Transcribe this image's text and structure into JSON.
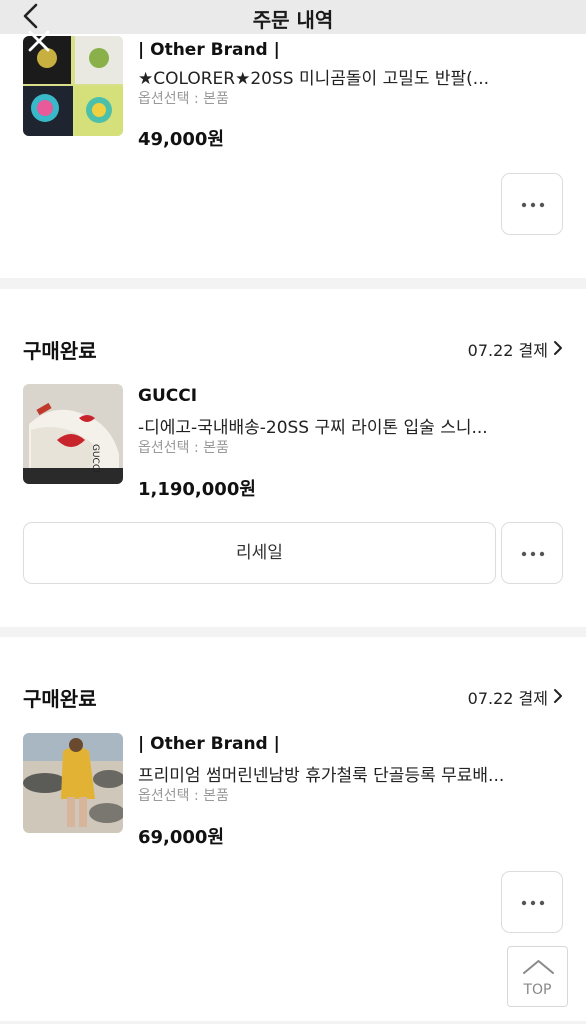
{
  "header": {
    "title": "주문 내역"
  },
  "orders": [
    {
      "status": "",
      "pay_date": "",
      "brand": "| Other Brand |",
      "name": "★COLORER★20SS 미니곰돌이 고밀도 반팔(...",
      "option": "옵션선택 : 본품",
      "price": "49,000원",
      "thumb_icon": "tshirt-photo"
    },
    {
      "status": "구매완료",
      "pay_date": "07.22 결제",
      "brand": "GUCCI",
      "name": "-디에고-국내배송-20SS 구찌 라이톤 입술 스니...",
      "option": "옵션선택 : 본품",
      "price": "1,190,000원",
      "resale_label": "리세일",
      "thumb_icon": "sneaker-photo"
    },
    {
      "status": "구매완료",
      "pay_date": "07.22 결제",
      "brand": "| Other Brand |",
      "name": "프리미엄 썸머린넨남방 휴가철룩 단골등록 무료배...",
      "option": "옵션선택 : 본품",
      "price": "69,000원",
      "thumb_icon": "shirt-photo"
    }
  ],
  "top_button": {
    "label": "TOP"
  },
  "colors": {
    "accent_text": "#111111",
    "muted": "#9a9a9a",
    "divider": "#f3f3f3",
    "border": "#dcdcdc"
  }
}
